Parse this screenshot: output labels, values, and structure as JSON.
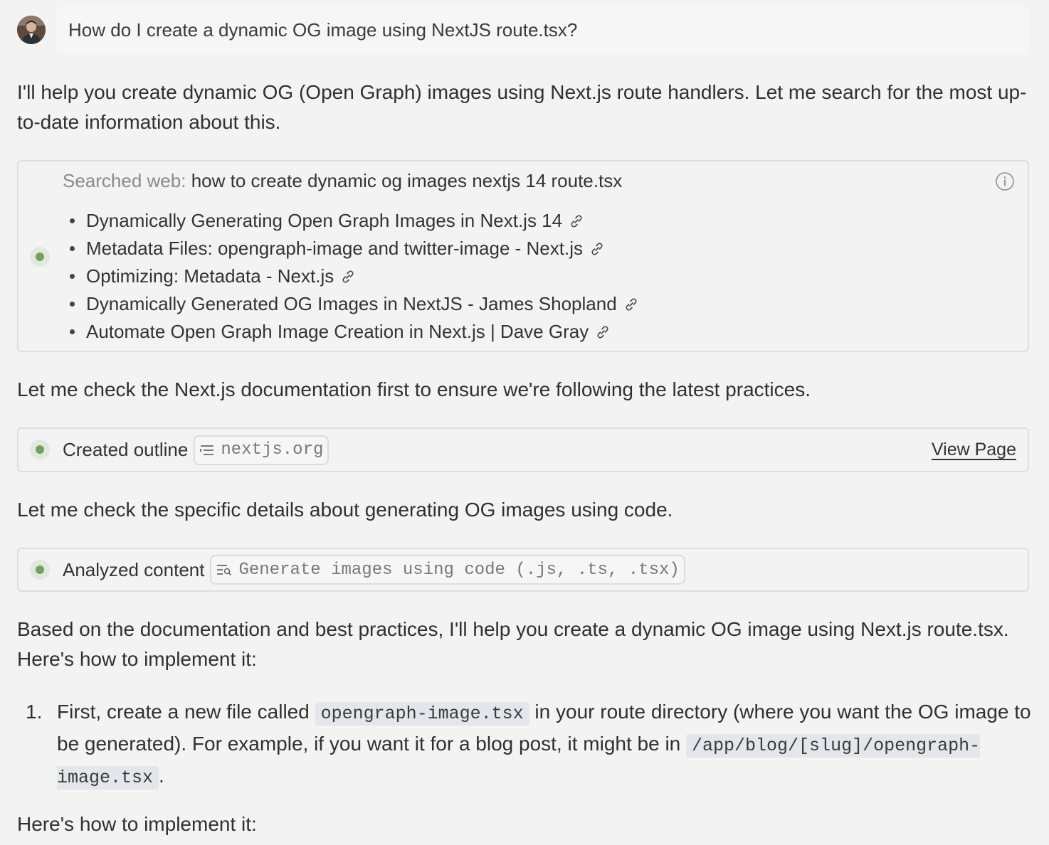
{
  "user_message": {
    "text": "How do I create a dynamic OG image using NextJS route.tsx?"
  },
  "assistant": {
    "intro": "I'll help you create dynamic OG (Open Graph) images using Next.js route handlers. Let me search for the most up-to-date information about this.",
    "search_card": {
      "label": "Searched web:",
      "query": "how to create dynamic og images nextjs 14 route.tsx",
      "results": [
        "Dynamically Generating Open Graph Images in Next.js 14",
        "Metadata Files: opengraph-image and twitter-image - Next.js",
        "Optimizing: Metadata - Next.js",
        "Dynamically Generated OG Images in NextJS - James Shopland",
        "Automate Open Graph Image Creation in Next.js | Dave Gray"
      ]
    },
    "check_docs": "Let me check the Next.js documentation first to ensure we're following the latest practices.",
    "outline_card": {
      "label": "Created outline",
      "chip": "nextjs.org",
      "action": "View Page"
    },
    "check_details": "Let me check the specific details about generating OG images using code.",
    "analyze_card": {
      "label": "Analyzed content",
      "chip": "Generate images using code (.js, .ts, .tsx)"
    },
    "based_on": "Based on the documentation and best practices, I'll help you create a dynamic OG image using Next.js route.tsx. Here's how to implement it:",
    "step1": {
      "number": "1.",
      "text_a": "First, create a new file called",
      "code_a": "opengraph-image.tsx",
      "text_b": "in your route directory (where you want the OG image to be generated). For example, if you want it for a blog post, it might be in",
      "code_b": "/app/blog/[slug]/opengraph-image.tsx",
      "text_c": "."
    },
    "implement": "Here's how to implement it:"
  },
  "colors": {
    "background": "#f3f3f3",
    "status_dot": "#74a05f",
    "code_bg": "#e4e6ec"
  }
}
